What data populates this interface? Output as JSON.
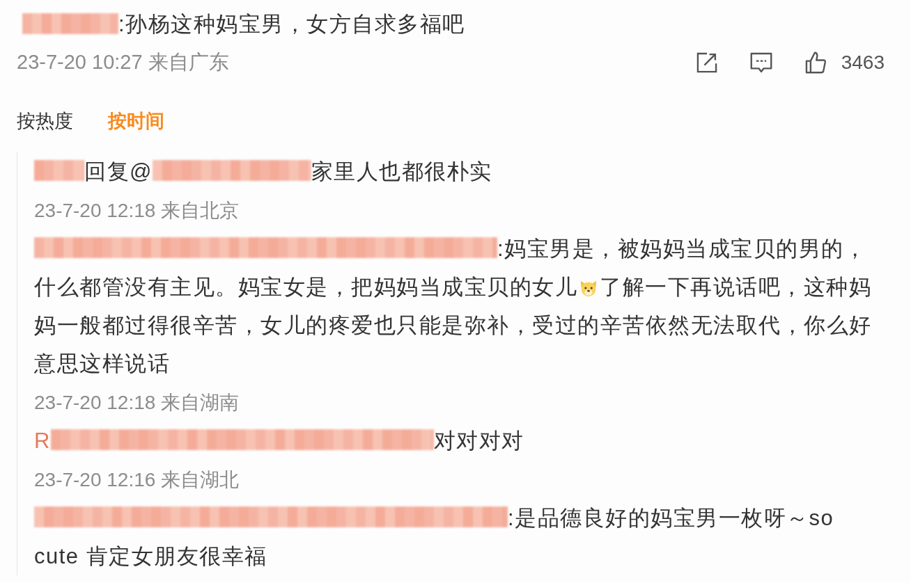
{
  "comment": {
    "segments": [
      {
        "kind": "redacted"
      },
      {
        "kind": "text",
        "text": ":孙杨这种妈宝男，女方自求多福吧"
      }
    ],
    "time": "23-7-20 10:27 来自广东",
    "actions": [
      {
        "kind": "share"
      },
      {
        "kind": "comment"
      },
      {
        "kind": "like",
        "count": "3463"
      }
    ]
  },
  "sort_tabs": [
    {
      "label": "按热度",
      "selected": false
    },
    {
      "label": "按时间",
      "selected": true
    }
  ],
  "replies": [
    {
      "lines": [
        [
          {
            "kind": "redacted"
          },
          {
            "kind": "text",
            "text": "回复@"
          },
          {
            "kind": "redacted"
          },
          {
            "kind": "text",
            "text": "家里人也都很朴实"
          }
        ]
      ],
      "time": "23-7-20 12:18 来自北京"
    },
    {
      "lines": [
        [
          {
            "kind": "redacted"
          },
          {
            "kind": "text",
            "text": ":妈宝男是，被妈妈当成宝贝的男的，"
          }
        ],
        [
          {
            "kind": "text",
            "text": "什么都管没有主见。妈宝女是，把妈妈当成宝贝的女儿"
          },
          {
            "kind": "emoji"
          },
          {
            "kind": "text",
            "text": "了解一下再说话吧，这种妈"
          }
        ],
        [
          {
            "kind": "text",
            "text": "妈一般都过得很辛苦，女儿的疼爱也只能是弥补，受过的辛苦依然无法取代，你么好"
          }
        ],
        [
          {
            "kind": "text",
            "text": "意思这样说话"
          }
        ]
      ],
      "time": "23-7-20 12:18 来自湖南"
    },
    {
      "lines": [
        [
          {
            "kind": "name",
            "text": "R"
          },
          {
            "kind": "redacted"
          },
          {
            "kind": "text",
            "text": "对对对对"
          }
        ]
      ],
      "time": "23-7-20 12:16 来自湖北"
    },
    {
      "lines": [
        [
          {
            "kind": "redacted"
          },
          {
            "kind": "text",
            "text": ":是品德良好的妈宝男一枚呀～so"
          }
        ],
        [
          {
            "kind": "text",
            "text": "cute 肯定女朋友很幸福"
          }
        ]
      ]
    }
  ]
}
